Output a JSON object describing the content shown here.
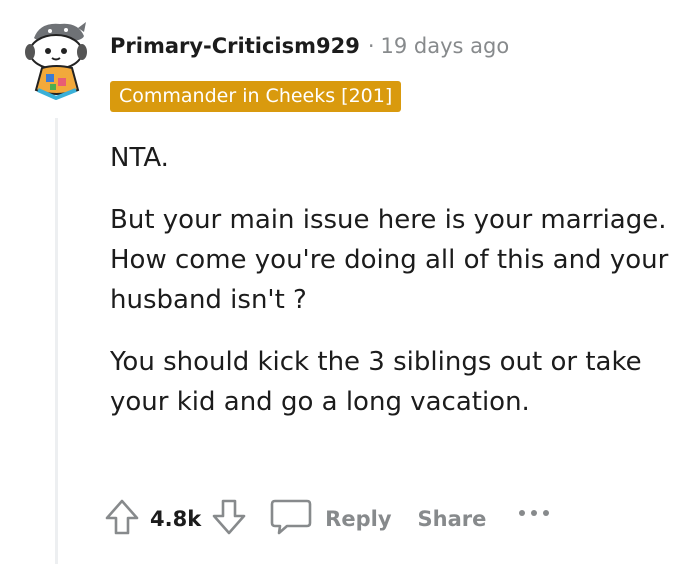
{
  "comment": {
    "username": "Primary-Criticism929",
    "separator": "·",
    "time_ago": "19 days ago",
    "flair": "Commander in Cheeks [201]",
    "paragraphs": [
      "NTA.",
      "But your main issue here is your marriage. How come you're doing all of this and your husband isn't ?",
      "You should kick the 3 siblings out or take your kid and go a long vacation."
    ]
  },
  "actions": {
    "upvote_icon": "arrow-up-icon",
    "vote_count": "4.8k",
    "downvote_icon": "arrow-down-icon",
    "reply_icon": "speech-bubble-icon",
    "reply_label": "Reply",
    "share_label": "Share",
    "more_icon": "more-dots-icon"
  },
  "colors": {
    "flair_bg": "#d99a0e",
    "muted_text": "#878a8c",
    "text": "#1c1c1c",
    "thread_line": "#edeff1"
  }
}
